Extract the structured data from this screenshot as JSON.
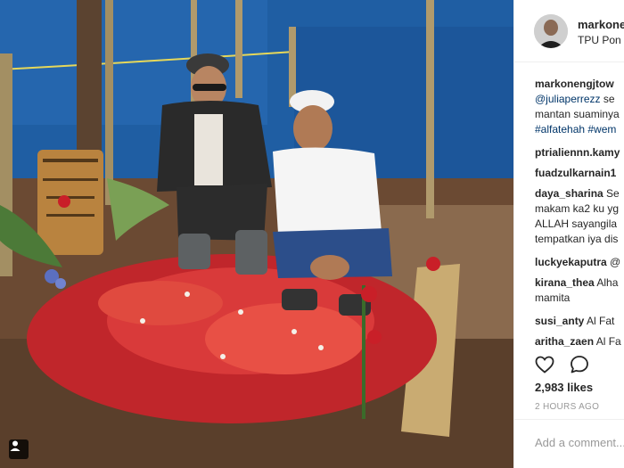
{
  "post": {
    "username": "markone",
    "location": "TPU Pon",
    "photo_alt": "Two men kneeling by a grave covered in red flower petals"
  },
  "comments": [
    {
      "user": "markonengjtow",
      "lines": [
        {
          "text": "@juliaperrezz",
          "style": "blue",
          "suffix": " se"
        },
        {
          "text": "mantan suaminya",
          "style": "plain"
        },
        {
          "text": "#alfatehah #wem",
          "style": "blue"
        }
      ]
    },
    {
      "user": "ptrialiennn.kamy",
      "lines": []
    },
    {
      "user": "fuadzulkarnain1",
      "lines": []
    },
    {
      "user": "daya_sharina",
      "inline": " Se",
      "lines": [
        {
          "text": "makam ka2 ku yg",
          "style": "plain"
        },
        {
          "text": "ALLAH sayangila",
          "style": "plain"
        },
        {
          "text": "tempatkan iya dis",
          "style": "plain"
        }
      ]
    },
    {
      "user": "luckyekaputra",
      "inline": " @",
      "lines": []
    },
    {
      "user": "kirana_thea",
      "inline": " Alha",
      "lines": [
        {
          "text": "mamita",
          "style": "plain"
        }
      ]
    },
    {
      "user": "susi_anty",
      "inline": " Al Fat",
      "lines": []
    },
    {
      "user": "aritha_zaen",
      "inline": " Al Fa",
      "lines": []
    }
  ],
  "actions": {
    "like_icon": "heart-icon",
    "comment_icon": "speech-bubble-icon"
  },
  "likes": "2,983 likes",
  "time_ago": "2 HOURS AGO",
  "add_comment_placeholder": "Add a comment...",
  "photo_tag_icon": "person-tag-icon"
}
